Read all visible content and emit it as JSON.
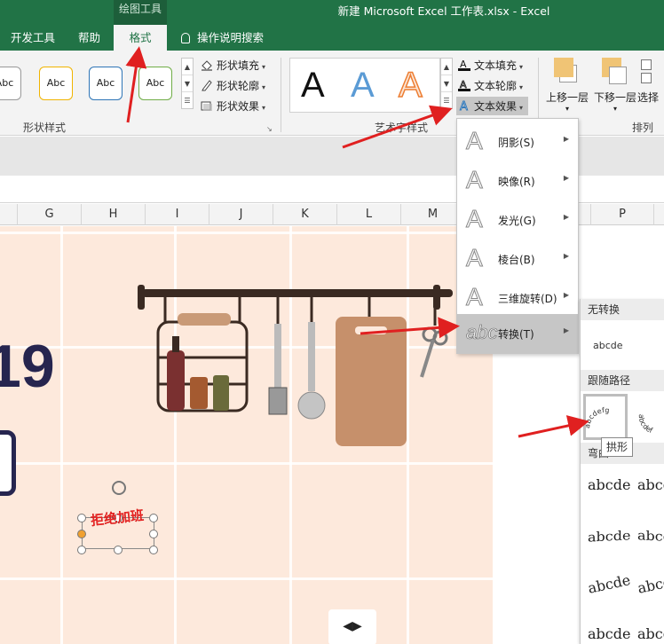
{
  "window": {
    "context_tools": "绘图工具",
    "title": "新建 Microsoft Excel 工作表.xlsx  -  Excel"
  },
  "tabs": {
    "developer": "开发工具",
    "help": "帮助",
    "format": "格式",
    "search": "操作说明搜索"
  },
  "ribbon": {
    "shape_styles": {
      "sample": "Abc",
      "fill": "形状填充",
      "outline": "形状轮廓",
      "effects": "形状效果",
      "group_label": "形状样式"
    },
    "wordart": {
      "sample": "A",
      "text_fill": "文本填充",
      "text_outline": "文本轮廓",
      "text_effects": "文本效果",
      "group_label": "艺术字样式"
    },
    "arrange": {
      "bring_forward": "上移一层",
      "send_backward": "下移一层",
      "select": "选择",
      "group_label": "排列"
    }
  },
  "columns": [
    "G",
    "H",
    "I",
    "J",
    "K",
    "L",
    "M",
    "P"
  ],
  "canvas": {
    "wordart_text": "拒绝加班",
    "partial_text": "19"
  },
  "text_effects_menu": {
    "items": [
      {
        "label": "阴影(S)",
        "icon": "A"
      },
      {
        "label": "映像(R)",
        "icon": "A"
      },
      {
        "label": "发光(G)",
        "icon": "A"
      },
      {
        "label": "棱台(B)",
        "icon": "A"
      },
      {
        "label": "三维旋转(D)",
        "icon": "A"
      },
      {
        "label": "转换(T)",
        "icon": "abc"
      }
    ]
  },
  "transform_panel": {
    "no_transform_header": "无转换",
    "no_transform_sample": "abcde",
    "follow_path_header": "跟随路径",
    "warp_header": "弯曲",
    "path_sample_text": "abcdefg",
    "path_sample_text_2": "abcdef",
    "warp_samples": [
      "abcde",
      "abcde",
      "abcde",
      "abcde",
      "abcde",
      "abcde",
      "abcde",
      "abcde"
    ],
    "tooltip": "拱形"
  },
  "colors": {
    "excel_green": "#217346",
    "sheet_bg": "#fde9dc",
    "annotation_red": "#e02020"
  }
}
